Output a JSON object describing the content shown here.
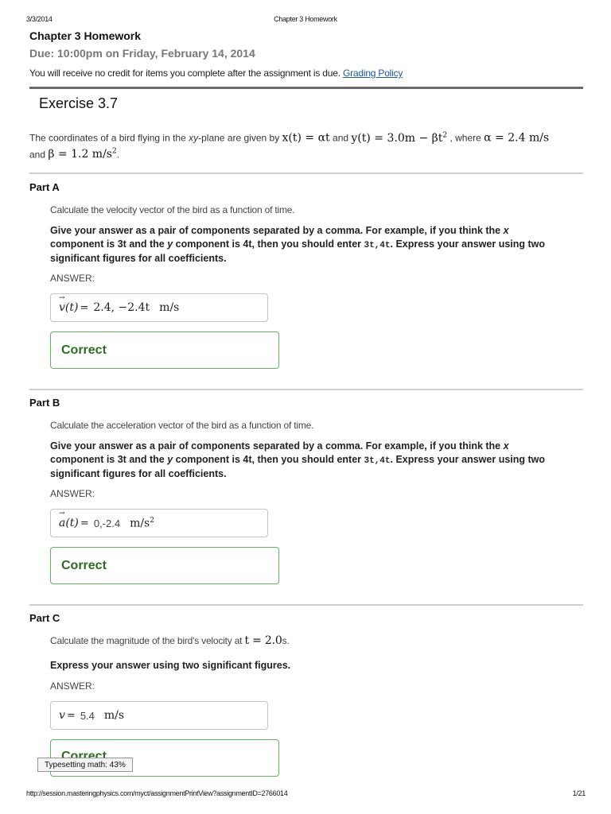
{
  "print_header": {
    "date": "3/3/2014",
    "title": "Chapter 3 Homework"
  },
  "assignment": {
    "title": "Chapter 3 Homework",
    "due": "Due: 10:00pm on Friday, February 14, 2014",
    "notice": "You will receive no credit for items you complete after the assignment is due.",
    "grading_policy_link": "Grading Policy"
  },
  "exercise": {
    "title": "Exercise 3.7",
    "intro_1": "The coordinates of a bird flying in the ",
    "intro_xy": "xy",
    "intro_2": "-plane are given by ",
    "x_eq": "x(t) = αt",
    "and_1": " and ",
    "y_eq": "y(t) = 3.0m − βt",
    "y_exp": "2",
    "where": " , where ",
    "alpha_eq": "α = 2.4 m/s",
    "and_2": "and ",
    "beta_eq": "β = 1.2 m/s",
    "beta_exp": "2",
    "end": "."
  },
  "parts": [
    {
      "label": "Part A",
      "question": "Calculate the velocity vector of the bird as a function of time.",
      "instr_1": "Give your answer as a pair of components separated by a comma. For example, if you think the ",
      "instr_x": "x",
      "instr_2": " component is 3t and the ",
      "instr_y": "y",
      "instr_3": " component is 4t, then you should enter ",
      "instr_code": "3t,4t",
      "instr_4": ". Express your answer using two significant figures for all coefficients.",
      "answer_label": "ANSWER:",
      "answer_lhs": "v(t)",
      "answer_eq": "=",
      "answer_value": "2.4, −2.4t",
      "answer_unit": "m/s",
      "status": "Correct"
    },
    {
      "label": "Part B",
      "question": "Calculate the acceleration vector of the bird as a function of time.",
      "instr_1": "Give your answer as a pair of components separated by a comma. For example, if you think the ",
      "instr_x": "x",
      "instr_2": " component is 3t and the ",
      "instr_y": "y",
      "instr_3": " component is 4t, then you should enter ",
      "instr_code": "3t,4t",
      "instr_4": ". Express your answer using two significant figures for all coefficients.",
      "answer_label": "ANSWER:",
      "answer_lhs": "a(t)",
      "answer_eq": "=",
      "answer_value": "0,-2.4",
      "answer_unit": "m/s",
      "answer_unit_exp": "2",
      "status": "Correct"
    },
    {
      "label": "Part C",
      "question_1": "Calculate the magnitude of the bird's velocity at ",
      "question_math": "t = 2.0",
      "question_2": "s.",
      "instr": "Express your answer using two significant figures.",
      "answer_label": "ANSWER:",
      "answer_lhs": "v",
      "answer_eq": "=",
      "answer_value": "5.4",
      "answer_unit": "m/s",
      "status": "Correct"
    }
  ],
  "typesetting_status": "Typesetting math: 43%",
  "footer": {
    "url": "http://session.masteringphysics.com/myct/assignmentPrintView?assignmentID=2766014",
    "page": "1/21"
  }
}
